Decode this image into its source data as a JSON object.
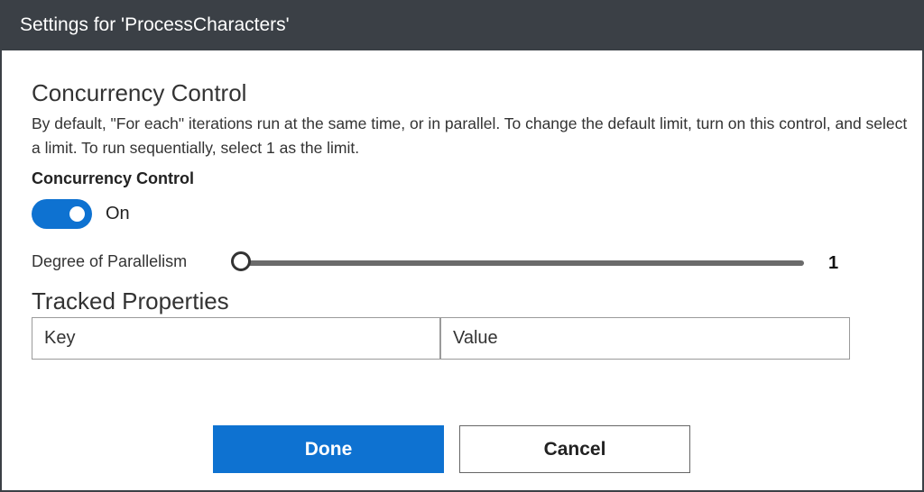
{
  "dialog": {
    "title": "Settings for 'ProcessCharacters'"
  },
  "concurrency": {
    "heading": "Concurrency Control",
    "description": "By default, \"For each\" iterations run at the same time, or in parallel. To change the default limit, turn on this control, and select a limit. To run sequentially, select 1 as the limit.",
    "toggle_label": "Concurrency Control",
    "toggle_state": "On",
    "toggle_on": true,
    "parallelism_label": "Degree of Parallelism",
    "parallelism_value": "1"
  },
  "tracked": {
    "heading": "Tracked Properties",
    "key_placeholder": "Key",
    "value_placeholder": "Value"
  },
  "buttons": {
    "done": "Done",
    "cancel": "Cancel"
  },
  "colors": {
    "accent": "#0e72d1",
    "titlebar": "#3b4046"
  }
}
